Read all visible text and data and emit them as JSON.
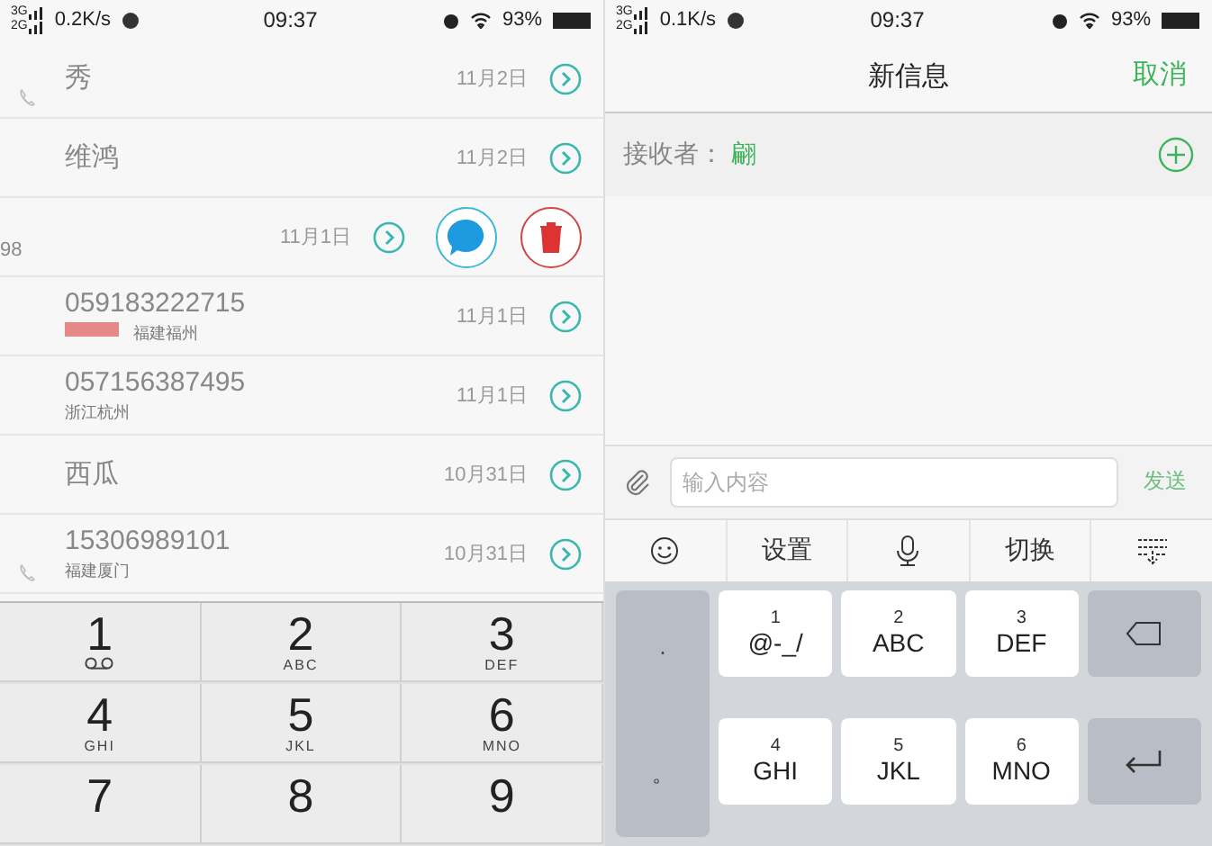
{
  "left_phone": {
    "status_bar": {
      "network_top": "3G",
      "network_bottom": "2G",
      "speed": "0.2K/s",
      "time": "09:37",
      "battery": "93%"
    },
    "call_log": [
      {
        "kind": "normal",
        "name": "秀",
        "date": "11月2日",
        "call_icon": true,
        "flagged": false
      },
      {
        "kind": "normal",
        "name": "维鸿",
        "date": "11月2日",
        "call_icon": false,
        "flagged": false
      },
      {
        "kind": "swiped",
        "name": "98",
        "date": "11月1日"
      },
      {
        "kind": "normal",
        "name": "059183222715",
        "detail": "福建福州",
        "date": "11月1日",
        "call_icon": false,
        "flagged": true
      },
      {
        "kind": "normal",
        "name": "057156387495",
        "detail": "浙江杭州",
        "date": "11月1日",
        "call_icon": false,
        "flagged": false
      },
      {
        "kind": "normal",
        "name": "西瓜",
        "date": "10月31日",
        "call_icon": false,
        "flagged": false
      },
      {
        "kind": "normal",
        "name": "15306989101",
        "detail": "福建厦门",
        "date": "10月31日",
        "call_icon": true,
        "flagged": false
      }
    ],
    "dialpad": [
      {
        "kind": "voicemail",
        "digit": "1"
      },
      {
        "kind": "letters",
        "digit": "2",
        "letters": "ABC"
      },
      {
        "kind": "letters",
        "digit": "3",
        "letters": "DEF"
      },
      {
        "kind": "letters",
        "digit": "4",
        "letters": "GHI"
      },
      {
        "kind": "letters",
        "digit": "5",
        "letters": "JKL"
      },
      {
        "kind": "letters",
        "digit": "6",
        "letters": "MNO"
      },
      {
        "kind": "digit",
        "digit": "7"
      },
      {
        "kind": "digit",
        "digit": "8"
      },
      {
        "kind": "digit",
        "digit": "9"
      }
    ]
  },
  "right_phone": {
    "status_bar": {
      "network_top": "3G",
      "network_bottom": "2G",
      "speed": "0.1K/s",
      "time": "09:37",
      "battery": "93%"
    },
    "header": {
      "title": "新信息",
      "cancel": "取消"
    },
    "recipient": {
      "label": "接收者：",
      "value": "翩"
    },
    "compose": {
      "placeholder": "输入内容",
      "send": "发送",
      "send_disabled": true
    },
    "toolbar": {
      "settings": "设置",
      "switch": "切换"
    },
    "keyboard": {
      "left_keys": [
        "·",
        "。"
      ],
      "keys": [
        {
          "kind": "key",
          "digit": "1",
          "letters": "@-_/"
        },
        {
          "kind": "key",
          "digit": "2",
          "letters": "ABC"
        },
        {
          "kind": "key",
          "digit": "3",
          "letters": "DEF"
        },
        {
          "kind": "backspace"
        },
        {
          "kind": "key",
          "digit": "4",
          "letters": "GHI"
        },
        {
          "kind": "key",
          "digit": "5",
          "letters": "JKL"
        },
        {
          "kind": "key",
          "digit": "6",
          "letters": "MNO"
        },
        {
          "kind": "enter"
        }
      ]
    }
  }
}
